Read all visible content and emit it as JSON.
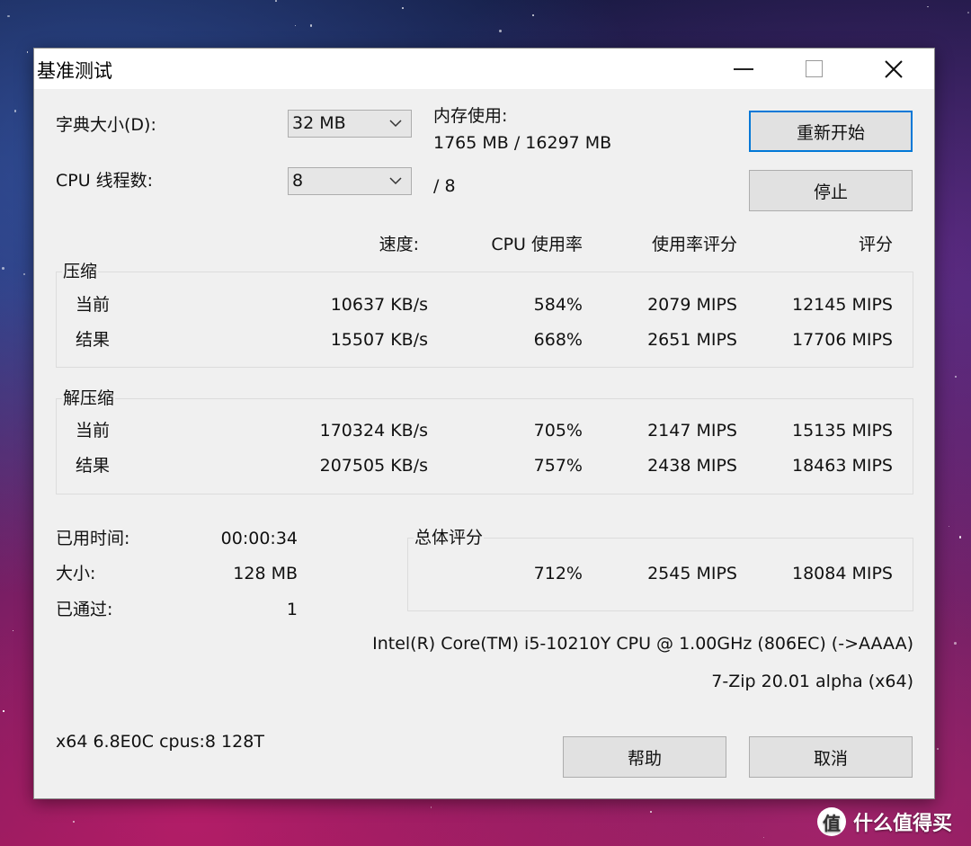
{
  "window": {
    "title": "基准测试",
    "controls": {
      "minimize": "minimize-icon",
      "maximize": "maximize-icon",
      "close": "close-icon"
    }
  },
  "settings": {
    "dict_label": "字典大小(D):",
    "dict_value": "32 MB",
    "threads_label": "CPU 线程数:",
    "threads_value": "8",
    "threads_total": "/ 8"
  },
  "memory": {
    "label": "内存使用:",
    "value": "1765 MB / 16297 MB"
  },
  "buttons": {
    "restart": "重新开始",
    "stop": "停止",
    "help": "帮助",
    "cancel": "取消"
  },
  "columns": {
    "speed": "速度:",
    "cpu_usage": "CPU 使用率",
    "usage_rating": "使用率评分",
    "rating": "评分"
  },
  "compress": {
    "label": "压缩",
    "rows": [
      {
        "name": "当前",
        "speed": "10637 KB/s",
        "cpu": "584%",
        "usage_rating": "2079 MIPS",
        "rating": "12145 MIPS"
      },
      {
        "name": "结果",
        "speed": "15507 KB/s",
        "cpu": "668%",
        "usage_rating": "2651 MIPS",
        "rating": "17706 MIPS"
      }
    ]
  },
  "decompress": {
    "label": "解压缩",
    "rows": [
      {
        "name": "当前",
        "speed": "170324 KB/s",
        "cpu": "705%",
        "usage_rating": "2147 MIPS",
        "rating": "15135 MIPS"
      },
      {
        "name": "结果",
        "speed": "207505 KB/s",
        "cpu": "757%",
        "usage_rating": "2438 MIPS",
        "rating": "18463 MIPS"
      }
    ]
  },
  "stats": {
    "elapsed_label": "已用时间:",
    "elapsed_value": "00:00:34",
    "size_label": "大小:",
    "size_value": "128 MB",
    "passes_label": "已通过:",
    "passes_value": "1"
  },
  "total": {
    "label": "总体评分",
    "cpu": "712%",
    "usage_rating": "2545 MIPS",
    "rating": "18084 MIPS"
  },
  "info": {
    "cpu_name": "Intel(R) Core(TM) i5-10210Y CPU @ 1.00GHz (806EC) (->AAAA)",
    "version": "7-Zip 20.01 alpha (x64)",
    "sys": "x64 6.8E0C cpus:8 128T"
  },
  "watermark": {
    "logo": "值",
    "text": "什么值得买"
  },
  "colors": {
    "accent": "#0078d7",
    "window_bg": "#f0f0f0",
    "button_bg": "#e1e1e1"
  }
}
